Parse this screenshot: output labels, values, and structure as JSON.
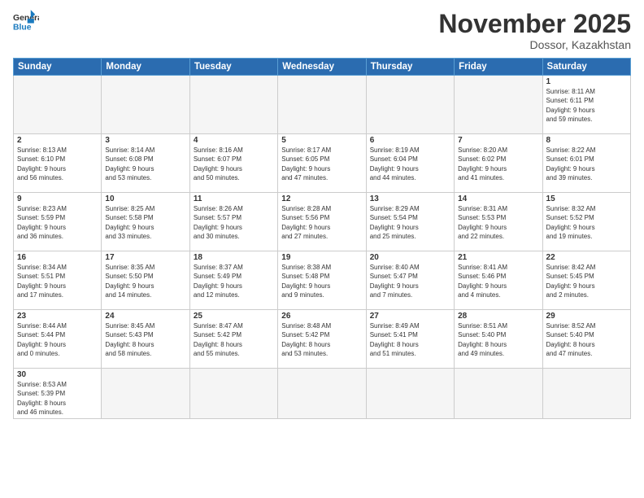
{
  "header": {
    "logo_general": "General",
    "logo_blue": "Blue",
    "month_title": "November 2025",
    "location": "Dossor, Kazakhstan"
  },
  "days_of_week": [
    "Sunday",
    "Monday",
    "Tuesday",
    "Wednesday",
    "Thursday",
    "Friday",
    "Saturday"
  ],
  "weeks": [
    [
      {
        "day": "",
        "info": "",
        "empty": true
      },
      {
        "day": "",
        "info": "",
        "empty": true
      },
      {
        "day": "",
        "info": "",
        "empty": true
      },
      {
        "day": "",
        "info": "",
        "empty": true
      },
      {
        "day": "",
        "info": "",
        "empty": true
      },
      {
        "day": "",
        "info": "",
        "empty": true
      },
      {
        "day": "1",
        "info": "Sunrise: 8:11 AM\nSunset: 6:11 PM\nDaylight: 9 hours\nand 59 minutes.",
        "empty": false
      }
    ],
    [
      {
        "day": "2",
        "info": "Sunrise: 8:13 AM\nSunset: 6:10 PM\nDaylight: 9 hours\nand 56 minutes.",
        "empty": false
      },
      {
        "day": "3",
        "info": "Sunrise: 8:14 AM\nSunset: 6:08 PM\nDaylight: 9 hours\nand 53 minutes.",
        "empty": false
      },
      {
        "day": "4",
        "info": "Sunrise: 8:16 AM\nSunset: 6:07 PM\nDaylight: 9 hours\nand 50 minutes.",
        "empty": false
      },
      {
        "day": "5",
        "info": "Sunrise: 8:17 AM\nSunset: 6:05 PM\nDaylight: 9 hours\nand 47 minutes.",
        "empty": false
      },
      {
        "day": "6",
        "info": "Sunrise: 8:19 AM\nSunset: 6:04 PM\nDaylight: 9 hours\nand 44 minutes.",
        "empty": false
      },
      {
        "day": "7",
        "info": "Sunrise: 8:20 AM\nSunset: 6:02 PM\nDaylight: 9 hours\nand 41 minutes.",
        "empty": false
      },
      {
        "day": "8",
        "info": "Sunrise: 8:22 AM\nSunset: 6:01 PM\nDaylight: 9 hours\nand 39 minutes.",
        "empty": false
      }
    ],
    [
      {
        "day": "9",
        "info": "Sunrise: 8:23 AM\nSunset: 5:59 PM\nDaylight: 9 hours\nand 36 minutes.",
        "empty": false
      },
      {
        "day": "10",
        "info": "Sunrise: 8:25 AM\nSunset: 5:58 PM\nDaylight: 9 hours\nand 33 minutes.",
        "empty": false
      },
      {
        "day": "11",
        "info": "Sunrise: 8:26 AM\nSunset: 5:57 PM\nDaylight: 9 hours\nand 30 minutes.",
        "empty": false
      },
      {
        "day": "12",
        "info": "Sunrise: 8:28 AM\nSunset: 5:56 PM\nDaylight: 9 hours\nand 27 minutes.",
        "empty": false
      },
      {
        "day": "13",
        "info": "Sunrise: 8:29 AM\nSunset: 5:54 PM\nDaylight: 9 hours\nand 25 minutes.",
        "empty": false
      },
      {
        "day": "14",
        "info": "Sunrise: 8:31 AM\nSunset: 5:53 PM\nDaylight: 9 hours\nand 22 minutes.",
        "empty": false
      },
      {
        "day": "15",
        "info": "Sunrise: 8:32 AM\nSunset: 5:52 PM\nDaylight: 9 hours\nand 19 minutes.",
        "empty": false
      }
    ],
    [
      {
        "day": "16",
        "info": "Sunrise: 8:34 AM\nSunset: 5:51 PM\nDaylight: 9 hours\nand 17 minutes.",
        "empty": false
      },
      {
        "day": "17",
        "info": "Sunrise: 8:35 AM\nSunset: 5:50 PM\nDaylight: 9 hours\nand 14 minutes.",
        "empty": false
      },
      {
        "day": "18",
        "info": "Sunrise: 8:37 AM\nSunset: 5:49 PM\nDaylight: 9 hours\nand 12 minutes.",
        "empty": false
      },
      {
        "day": "19",
        "info": "Sunrise: 8:38 AM\nSunset: 5:48 PM\nDaylight: 9 hours\nand 9 minutes.",
        "empty": false
      },
      {
        "day": "20",
        "info": "Sunrise: 8:40 AM\nSunset: 5:47 PM\nDaylight: 9 hours\nand 7 minutes.",
        "empty": false
      },
      {
        "day": "21",
        "info": "Sunrise: 8:41 AM\nSunset: 5:46 PM\nDaylight: 9 hours\nand 4 minutes.",
        "empty": false
      },
      {
        "day": "22",
        "info": "Sunrise: 8:42 AM\nSunset: 5:45 PM\nDaylight: 9 hours\nand 2 minutes.",
        "empty": false
      }
    ],
    [
      {
        "day": "23",
        "info": "Sunrise: 8:44 AM\nSunset: 5:44 PM\nDaylight: 9 hours\nand 0 minutes.",
        "empty": false
      },
      {
        "day": "24",
        "info": "Sunrise: 8:45 AM\nSunset: 5:43 PM\nDaylight: 8 hours\nand 58 minutes.",
        "empty": false
      },
      {
        "day": "25",
        "info": "Sunrise: 8:47 AM\nSunset: 5:42 PM\nDaylight: 8 hours\nand 55 minutes.",
        "empty": false
      },
      {
        "day": "26",
        "info": "Sunrise: 8:48 AM\nSunset: 5:42 PM\nDaylight: 8 hours\nand 53 minutes.",
        "empty": false
      },
      {
        "day": "27",
        "info": "Sunrise: 8:49 AM\nSunset: 5:41 PM\nDaylight: 8 hours\nand 51 minutes.",
        "empty": false
      },
      {
        "day": "28",
        "info": "Sunrise: 8:51 AM\nSunset: 5:40 PM\nDaylight: 8 hours\nand 49 minutes.",
        "empty": false
      },
      {
        "day": "29",
        "info": "Sunrise: 8:52 AM\nSunset: 5:40 PM\nDaylight: 8 hours\nand 47 minutes.",
        "empty": false
      }
    ],
    [
      {
        "day": "30",
        "info": "Sunrise: 8:53 AM\nSunset: 5:39 PM\nDaylight: 8 hours\nand 46 minutes.",
        "empty": false,
        "last": true
      },
      {
        "day": "",
        "info": "",
        "empty": true,
        "last": true
      },
      {
        "day": "",
        "info": "",
        "empty": true,
        "last": true
      },
      {
        "day": "",
        "info": "",
        "empty": true,
        "last": true
      },
      {
        "day": "",
        "info": "",
        "empty": true,
        "last": true
      },
      {
        "day": "",
        "info": "",
        "empty": true,
        "last": true
      },
      {
        "day": "",
        "info": "",
        "empty": true,
        "last": true
      }
    ]
  ]
}
